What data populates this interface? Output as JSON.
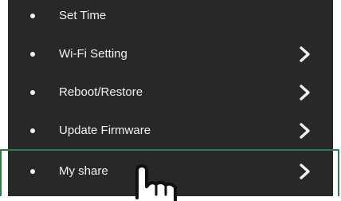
{
  "menu": {
    "items": [
      {
        "label": "Set Time",
        "has_arrow": false
      },
      {
        "label": "Wi-Fi Setting",
        "has_arrow": true
      },
      {
        "label": "Reboot/Restore",
        "has_arrow": true
      },
      {
        "label": "Update Firmware",
        "has_arrow": true
      },
      {
        "label": "My share",
        "has_arrow": true,
        "highlighted": true
      }
    ]
  },
  "icons": {
    "bullet": "bullet-dot-icon",
    "arrow": "chevron-right-icon",
    "pointer": "hand-pointer-icon"
  },
  "colors": {
    "panel_background": "#282828",
    "text": "#f2f2f2",
    "highlight_border": "#2e7d4f"
  }
}
